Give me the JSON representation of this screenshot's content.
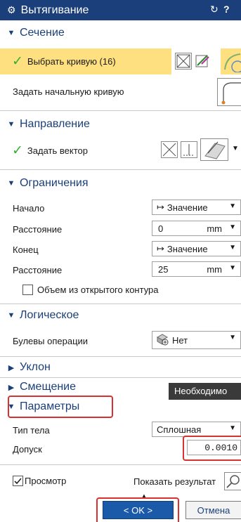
{
  "title_bar": {
    "gear_icon": "gear-icon",
    "title": "Вытягивание",
    "reset_glyph": "↻",
    "help_glyph": "?"
  },
  "sections": {
    "section": {
      "title": "Сечение",
      "select_curve": "Выбрать кривую (16)",
      "start_curve": "Задать начальную кривую"
    },
    "direction": {
      "title": "Направление",
      "set_vector": "Задать вектор"
    },
    "limits": {
      "title": "Ограничения",
      "start_label": "Начало",
      "start_value": "Значение",
      "distance1_label": "Расстояние",
      "distance1_value": "0",
      "distance1_unit": "mm",
      "end_label": "Конец",
      "end_value": "Значение",
      "distance2_label": "Расстояние",
      "distance2_value": "25",
      "distance2_unit": "mm",
      "open_profile_label": "Объем из открытого контура",
      "open_profile_checked": false
    },
    "boolean": {
      "title": "Логическое",
      "op_label": "Булевы операции",
      "op_value": "Нет"
    },
    "draft": {
      "title": "Уклон"
    },
    "offset": {
      "title": "Смещение"
    },
    "settings": {
      "title": "Параметры",
      "body_type_label": "Тип тела",
      "body_type_value": "Сплошная",
      "tolerance_label": "Допуск",
      "tolerance_value": "0.0010"
    }
  },
  "tooltip": "Необходимо",
  "preview": {
    "label": "Просмотр",
    "checked": true,
    "show_result": "Показать результат"
  },
  "buttons": {
    "ok": "< OK >",
    "cancel": "Отмена"
  },
  "colors": {
    "titlebar": "#1a3f7a",
    "section_text": "#1a3f7a",
    "highlight": "#ffe080",
    "check_green": "#35b035",
    "annotation_red": "#d93030",
    "ok_button": "#1a5aa8"
  }
}
